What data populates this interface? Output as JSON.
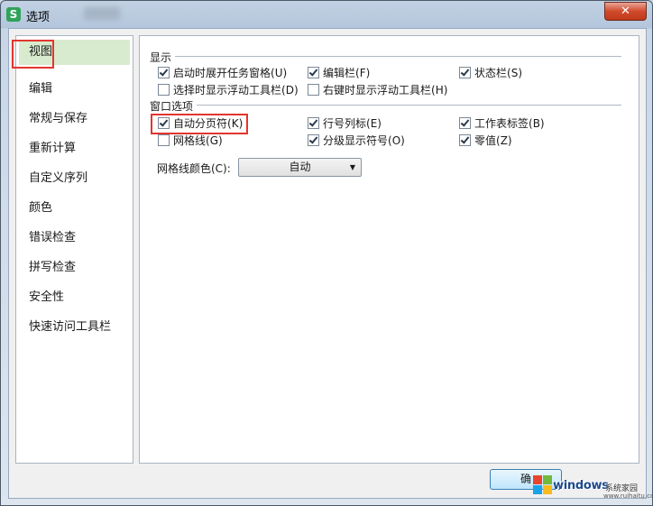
{
  "window": {
    "title": "选项",
    "close_glyph": "✕"
  },
  "nav": {
    "items": [
      "视图",
      "编辑",
      "常规与保存",
      "重新计算",
      "自定义序列",
      "颜色",
      "错误检查",
      "拼写检查",
      "安全性",
      "快速访问工具栏"
    ],
    "selected": "视图"
  },
  "display": {
    "title": "显示",
    "options": [
      {
        "label": "启动时展开任务窗格",
        "hotkey": "(U)",
        "checked": true
      },
      {
        "label": "编辑栏",
        "hotkey": "(F)",
        "checked": true
      },
      {
        "label": "状态栏",
        "hotkey": "(S)",
        "checked": true
      },
      {
        "label": "选择时显示浮动工具栏",
        "hotkey": "(D)",
        "checked": false
      },
      {
        "label": "右键时显示浮动工具栏",
        "hotkey": "(H)",
        "checked": false
      }
    ]
  },
  "window_options": {
    "title": "窗口选项",
    "options": [
      {
        "label": "自动分页符",
        "hotkey": "(K)",
        "checked": true
      },
      {
        "label": "行号列标",
        "hotkey": "(E)",
        "checked": true
      },
      {
        "label": "工作表标签",
        "hotkey": "(B)",
        "checked": true
      },
      {
        "label": "网格线",
        "hotkey": "(G)",
        "checked": false
      },
      {
        "label": "分级显示符号",
        "hotkey": "(O)",
        "checked": true
      },
      {
        "label": "零值",
        "hotkey": "(Z)",
        "checked": true
      }
    ],
    "gridline_color_label": "网格线颜色(C):",
    "gridline_color_value": "自动"
  },
  "buttons": {
    "ok": "确"
  },
  "watermark": {
    "brand": "windows",
    "sub": "系统家园",
    "url": "www.ruihaitu.com"
  },
  "colors": {
    "highlight": "#e2362e",
    "selected_bg": "#d8ebcf"
  }
}
